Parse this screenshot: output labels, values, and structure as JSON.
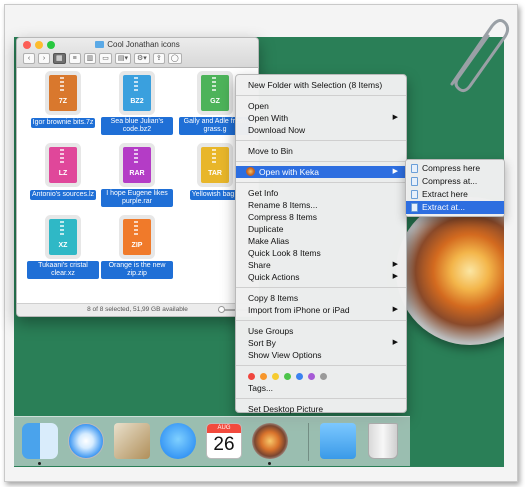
{
  "finder": {
    "title": "Cool Jonathan icons",
    "status": "8 of 8 selected, 51,99 GB available",
    "files": [
      {
        "ext": "7Z",
        "name": "Igor brownie bits.7z",
        "color": "#d9782d"
      },
      {
        "ext": "BZ2",
        "name": "Sea blue Julian's code.bz2",
        "color": "#3aa0de"
      },
      {
        "ext": "GZ",
        "name": "Gally and Adle fresh grass.g",
        "color": "#4db35a"
      },
      {
        "ext": "LZ",
        "name": "Antonio's sources.lz",
        "color": "#e0479a"
      },
      {
        "ext": "RAR",
        "name": "I hope Eugene likes purple.rar",
        "color": "#b43cc6"
      },
      {
        "ext": "TAR",
        "name": "Yellowish bag.t",
        "color": "#e8b62a"
      },
      {
        "ext": "XZ",
        "name": "Tukaani's cristal clear.xz",
        "color": "#2fb8c6"
      },
      {
        "ext": "ZIP",
        "name": "Orange is the new zip.zip",
        "color": "#f07a2a"
      }
    ]
  },
  "menu": {
    "items": [
      "New Folder with Selection (8 Items)",
      "Open",
      "Open With",
      "Download Now",
      "Move to Bin",
      "Open with Keka",
      "Get Info",
      "Rename 8 Items...",
      "Compress 8 Items",
      "Duplicate",
      "Make Alias",
      "Quick Look 8 Items",
      "Share",
      "Quick Actions",
      "Copy 8 Items",
      "Import from iPhone or iPad",
      "Use Groups",
      "Sort By",
      "Show View Options",
      "Tags...",
      "Set Desktop Picture"
    ],
    "tag_colors": [
      "#f0463e",
      "#f7962b",
      "#f6cb30",
      "#4cc44a",
      "#3b82f0",
      "#a65bd6",
      "#9a9a9a"
    ]
  },
  "submenu": {
    "items": [
      "Compress here",
      "Compress at...",
      "Extract here",
      "Extract at..."
    ]
  },
  "dock": {
    "calendar_month": "AUG",
    "calendar_day": "26"
  },
  "icons": {
    "finder": "finder-icon",
    "safari": "safari-icon",
    "mail": "mail-icon",
    "messages": "messages-icon",
    "calendar": "calendar-icon",
    "keka": "keka-icon",
    "downloads": "downloads-folder-icon",
    "trash": "trash-icon"
  }
}
